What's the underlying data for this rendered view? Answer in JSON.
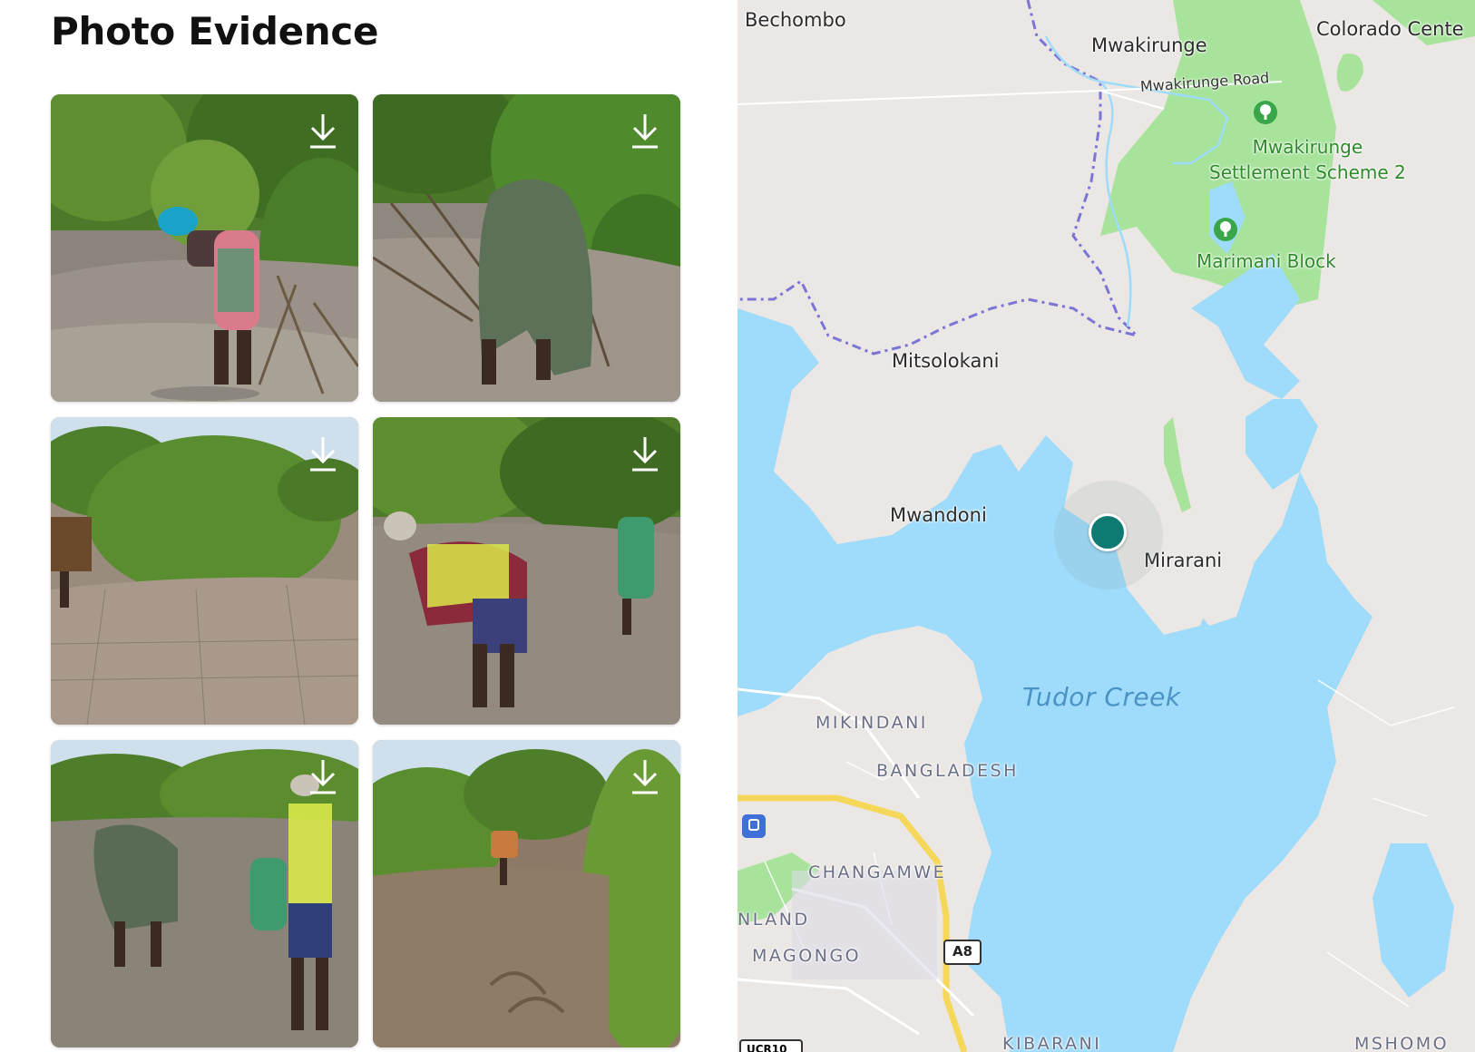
{
  "page": {
    "title": "Photo Evidence"
  },
  "photos": [
    {
      "alt": "Woman in headscarf planting mangrove seedlings",
      "download_icon": "download-icon"
    },
    {
      "alt": "Person in green raincoat bending among mangroves",
      "download_icon": "download-icon"
    },
    {
      "alt": "Mangrove bushes on cracked mudflat",
      "download_icon": "download-icon"
    },
    {
      "alt": "Man in hi-vis vest planting seedlings",
      "download_icon": "download-icon"
    },
    {
      "alt": "Group of workers planting on mudflat",
      "download_icon": "download-icon"
    },
    {
      "alt": "Worker among tall mangroves",
      "download_icon": "download-icon"
    }
  ],
  "map": {
    "labels": {
      "bechombo": "Bechombo",
      "mwakirunge": "Mwakirunge",
      "colorado": "Colorado Cente",
      "mwakirunge_road": "Mwakirunge Road",
      "settlement_line1": "Mwakirunge",
      "settlement_line2": "Settlement Scheme 2",
      "marimani": "Marimani Block",
      "mitsolokani": "Mitsolokani",
      "mwandoni": "Mwandoni",
      "mirarani": "Mirarani",
      "tudor_creek": "Tudor Creek",
      "mikindani": "MIKINDANI",
      "bangladesh": "BANGLADESH",
      "changamwe": "CHANGAMWE",
      "nland": "NLAND",
      "magongo": "MAGONGO",
      "kibarani": "KIBARANI",
      "mshomo": "MSHOMO",
      "a8": "A8",
      "b": "UCR10"
    },
    "colors": {
      "land": "#ebe7e4",
      "water": "#9fdcfb",
      "park": "#a8e39c",
      "marker": "#0f7a72",
      "boundary": "#7c75d6",
      "highway": "#f5d75a"
    }
  }
}
